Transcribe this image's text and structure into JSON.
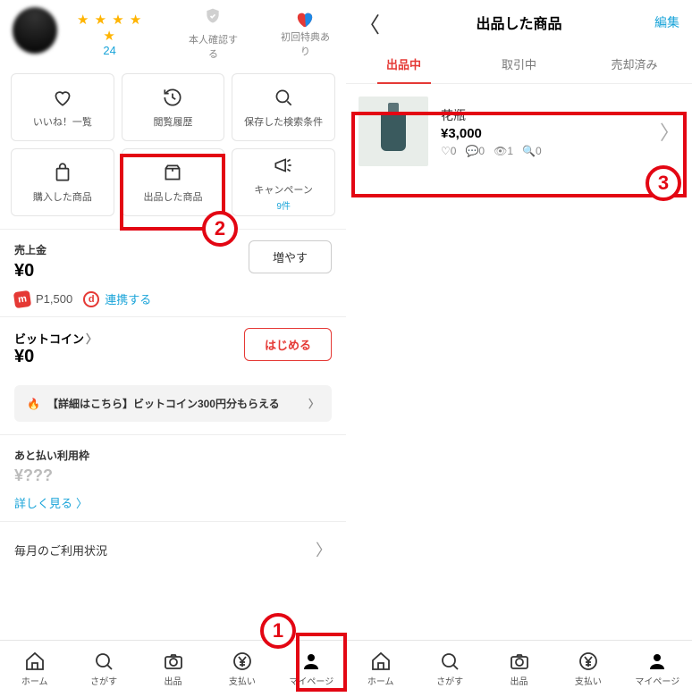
{
  "callouts": {
    "n1": "1",
    "n2": "2",
    "n3": "3"
  },
  "left": {
    "reviewCount": "24",
    "identity": "本人確認する",
    "firstBonus": "初回特典あり",
    "tiles": {
      "likes": "いいね！一覧",
      "history": "閲覧履歴",
      "savedSearch": "保存した検索条件",
      "purchased": "購入した商品",
      "listed": "出品した商品",
      "campaign": "キャンペーン",
      "campaignCount": "9件"
    },
    "sales": {
      "title": "売上金",
      "amount": "¥0",
      "increase": "増やす"
    },
    "points": {
      "value": "P1,500",
      "dLink": "連携する"
    },
    "bitcoin": {
      "title": "ビットコイン",
      "amount": "¥0",
      "start": "はじめる"
    },
    "promo": "【詳細はこちら】ビットコイン300円分もらえる",
    "postpay": {
      "title": "あと払い利用枠",
      "amount": "¥???",
      "detail": "詳しく見る"
    },
    "monthly": "毎月のご利用状況",
    "nav": {
      "home": "ホーム",
      "search": "さがす",
      "list": "出品",
      "pay": "支払い",
      "mypage": "マイページ"
    }
  },
  "right": {
    "title": "出品した商品",
    "edit": "編集",
    "tabs": {
      "listing": "出品中",
      "trading": "取引中",
      "sold": "売却済み"
    },
    "item": {
      "name": "花瓶",
      "price": "¥3,000",
      "likes": "0",
      "comments": "0",
      "views": "1",
      "other": "0"
    },
    "nav": {
      "home": "ホーム",
      "search": "さがす",
      "list": "出品",
      "pay": "支払い",
      "mypage": "マイページ"
    }
  }
}
